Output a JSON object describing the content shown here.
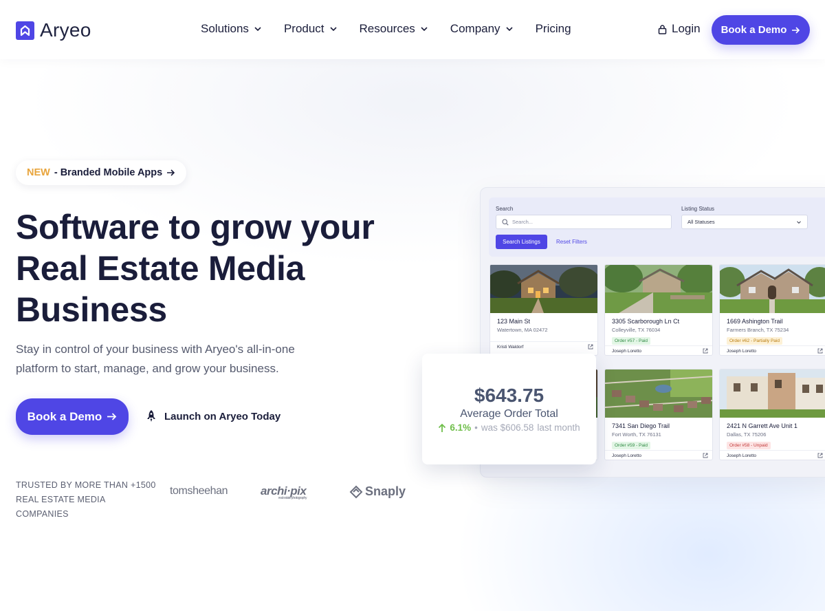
{
  "brand": {
    "name": "Aryeo",
    "accent": "#4f46e5"
  },
  "nav": {
    "items": [
      {
        "label": "Solutions",
        "dropdown": true
      },
      {
        "label": "Product",
        "dropdown": true
      },
      {
        "label": "Resources",
        "dropdown": true
      },
      {
        "label": "Company",
        "dropdown": true
      },
      {
        "label": "Pricing",
        "dropdown": false
      }
    ],
    "login_label": "Login",
    "cta_label": "Book a Demo"
  },
  "hero": {
    "badge_new": "NEW",
    "badge_text": "- Branded Mobile Apps",
    "headline": "Software to grow your Real Estate Media Business",
    "subtext": "Stay in control of your business with Aryeo's all-in-one platform to start, manage, and grow your business.",
    "cta_label": "Book a Demo",
    "launch_label": "Launch on Aryeo Today",
    "trusted_line1": "TRUSTED BY MORE THAN +1500",
    "trusted_line2": "REAL ESTATE MEDIA COMPANIES",
    "partners": {
      "tomsheehan": "tomsheehan",
      "archipix": "archi·pix",
      "archipix_sub": "real estate photography",
      "snaply": "Snaply"
    }
  },
  "dashboard": {
    "search_label": "Search",
    "search_placeholder": "Search...",
    "status_label": "Listing Status",
    "status_value": "All Statuses",
    "search_button": "Search Listings",
    "reset_link": "Reset Filters",
    "listings": [
      {
        "address": "123 Main St",
        "city": "Watertown, MA 02472",
        "badge": "",
        "agent": "Kristi Waldorf"
      },
      {
        "address": "3305 Scarborough Ln Ct",
        "city": "Colleyville, TX 76034",
        "badge": "Order #57 - Paid",
        "agent": "Joseph Loretto"
      },
      {
        "address": "1669 Ashington Trail",
        "city": "Farmers Branch, TX 75234",
        "badge": "Order #62 - Partially Paid",
        "agent": "Joseph Loretto"
      },
      {
        "address": "7341 San Diego Trail",
        "city": "Fort Worth, TX 76131",
        "badge": "Order #59 - Paid",
        "agent": "Joseph Loretto"
      },
      {
        "address": "2421 N Garrett Ave Unit 1",
        "city": "Dallas, TX 75206",
        "badge": "Order #58 - Unpaid",
        "agent": "Joseph Loretto"
      }
    ]
  },
  "stat": {
    "value": "$643.75",
    "label": "Average Order Total",
    "change": "6.1%",
    "previous": "was $606.58",
    "period": "last month"
  }
}
